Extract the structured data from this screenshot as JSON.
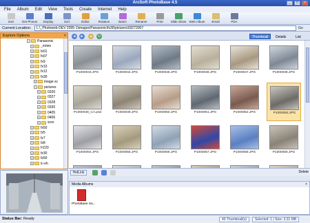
{
  "window": {
    "title": "ArcSoft PhotoBase 4.5"
  },
  "menu": [
    "File",
    "Album",
    "Edit",
    "View",
    "Tools",
    "Create",
    "Internet",
    "Help"
  ],
  "toolbar": [
    {
      "label": "Exit",
      "color": "#c9c9c9"
    },
    {
      "label": "Get Photos",
      "color": "#5b7fc8"
    },
    {
      "label": "Display",
      "color": "#4a6fb5"
    },
    {
      "label": "Sort",
      "color": "#7c94c9"
    },
    {
      "label": "Editor",
      "color": "#e0a040"
    },
    {
      "label": "Rotation",
      "color": "#6aa0d8"
    },
    {
      "label": "Batch",
      "color": "#b46ad8"
    },
    {
      "label": "Rename",
      "color": "#e0b050"
    },
    {
      "label": "Print",
      "color": "#9a9a9a"
    },
    {
      "label": "Slide Show",
      "color": "#4aa06a"
    },
    {
      "label": "Web Album",
      "color": "#3a8ad8"
    },
    {
      "label": "Email",
      "color": "#d8c070"
    },
    {
      "label": "PDA",
      "color": "#6a7a9a"
    }
  ],
  "location": {
    "label": "Current Location:",
    "path": "L:\\_Photoweb-DEV 2005-1\\images\\Panasonic\\fx30\\pictures\\03272007",
    "go": "Go"
  },
  "explore": {
    "title": "Explore Options",
    "close": "×"
  },
  "tree": [
    {
      "label": "Panasonic",
      "depth": 0,
      "expander": "−"
    },
    {
      "label": "_notes",
      "depth": 1,
      "expander": "+"
    },
    {
      "label": "fx01",
      "depth": 1,
      "expander": "+"
    },
    {
      "label": "fx07",
      "depth": 1,
      "expander": "+"
    },
    {
      "label": "fx9",
      "depth": 1,
      "expander": "+"
    },
    {
      "label": "fx10",
      "depth": 1,
      "expander": "+"
    },
    {
      "label": "fx12",
      "depth": 1,
      "expander": "+"
    },
    {
      "label": "fx30",
      "depth": 1,
      "expander": "−"
    },
    {
      "label": "image sc",
      "depth": 2,
      "expander": "+"
    },
    {
      "label": "pictures",
      "depth": 2,
      "expander": "−"
    },
    {
      "label": "0326",
      "depth": 3,
      "expander": "+"
    },
    {
      "label": "0327",
      "depth": 3,
      "expander": "+"
    },
    {
      "label": "0328",
      "depth": 3,
      "expander": "+"
    },
    {
      "label": "0330",
      "depth": 3,
      "expander": "+"
    },
    {
      "label": "0405",
      "depth": 3,
      "expander": "+"
    },
    {
      "label": "0406",
      "depth": 3,
      "expander": "+"
    },
    {
      "label": "scre",
      "depth": 3,
      "expander": "+"
    },
    {
      "label": "fx50",
      "depth": 1,
      "expander": "+"
    },
    {
      "label": "fz5",
      "depth": 1,
      "expander": "+"
    },
    {
      "label": "fz7",
      "depth": 1,
      "expander": "+"
    },
    {
      "label": "fz8",
      "depth": 1,
      "expander": "+"
    },
    {
      "label": "FZ20",
      "depth": 1,
      "expander": "+"
    },
    {
      "label": "fz30",
      "depth": 1,
      "expander": "+"
    },
    {
      "label": "fz50",
      "depth": 1,
      "expander": "+"
    },
    {
      "label": "lc-eh",
      "depth": 1,
      "expander": "+"
    }
  ],
  "view": {
    "thumbnail": "Thumbnail",
    "details": "Details",
    "list": "List"
  },
  "thumbs": [
    {
      "name": "P1000043.JPG",
      "c1": "#8a8f94",
      "c2": "#c7ccd2"
    },
    {
      "name": "P1000044.JPG",
      "c1": "#9aa8bd",
      "c2": "#d9dde5"
    },
    {
      "name": "P1000045.JPG",
      "c1": "#6d7a86",
      "c2": "#b5bdc6"
    },
    {
      "name": "P1000046.JPG",
      "c1": "#b9b09c",
      "c2": "#e2ded2"
    },
    {
      "name": "P1000047.JPG",
      "c1": "#a89880",
      "c2": "#e7e3da"
    },
    {
      "name": "P1000048.JPG",
      "c1": "#7e8894",
      "c2": "#cfd6df"
    },
    {
      "name": "P1000048_CA.psd",
      "c1": "#a8a397",
      "c2": "#dcdad2"
    },
    {
      "name": "P1000049.JPG",
      "c1": "#8d8475",
      "c2": "#cfcabd"
    },
    {
      "name": "P1000050.JPG",
      "c1": "#b79c86",
      "c2": "#e8dfd6"
    },
    {
      "name": "P1000051.JPG",
      "c1": "#5f6770",
      "c2": "#b8bdc3"
    },
    {
      "name": "P1000052.JPG",
      "c1": "#7a5a4f",
      "c2": "#c8a698"
    },
    {
      "name": "P1000053.JPG",
      "c1": "#6e6a66",
      "c2": "#c9c6c2",
      "selected": true
    },
    {
      "name": "P1000054.JPG",
      "c1": "#9c9ea3",
      "c2": "#e3e4e6"
    },
    {
      "name": "P1000055.JPG",
      "c1": "#a59a7c",
      "c2": "#d8d1bd"
    },
    {
      "name": "P1000056.JPG",
      "c1": "#8fa1b5",
      "c2": "#d2dce6"
    },
    {
      "name": "P1000057.JPG",
      "c1": "#2f48a8",
      "c2": "#d04a3a"
    },
    {
      "name": "P1000058.JPG",
      "c1": "#5a7fc2",
      "c2": "#a8c0e6"
    },
    {
      "name": "P1000059.JPG",
      "c1": "#8a8276",
      "c2": "#c9c3ba"
    },
    {
      "name": "",
      "c1": "#8f8f8f",
      "c2": "#c4c4c4"
    },
    {
      "name": "",
      "c1": "#9ba3ab",
      "c2": "#d6dadf"
    },
    {
      "name": "",
      "c1": "#7f8891",
      "c2": "#c2c8ce"
    },
    {
      "name": "",
      "c1": "#9a8f83",
      "c2": "#d4cdc4"
    },
    {
      "name": "",
      "c1": "#8a93a0",
      "c2": "#cdd3da"
    },
    {
      "name": "",
      "c1": "#a1988b",
      "c2": "#dcd7cf"
    }
  ],
  "tray": {
    "hotlink": "HotLink",
    "delete": "Delete"
  },
  "albums": {
    "title": "Media Albums",
    "item": "PhotoBase Sa...",
    "close": "×"
  },
  "status": {
    "label": "Status Bar:",
    "value": "Ready",
    "thumbnails": "40 Thumbnail(s)",
    "selected": "Selected: 1 | Size: 3.31 MB"
  }
}
